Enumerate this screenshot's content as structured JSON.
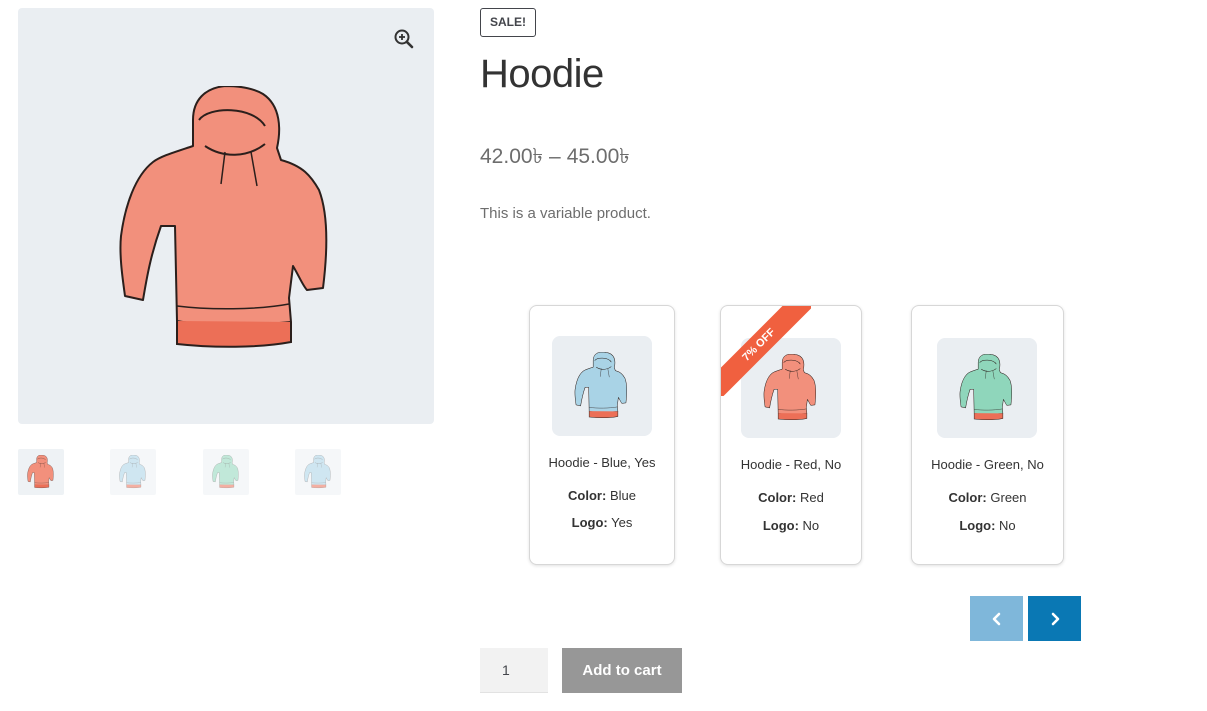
{
  "product": {
    "sale_badge": "SALE!",
    "title": "Hoodie",
    "price_min": "42.00৳",
    "price_separator": "–",
    "price_max": "45.00৳",
    "description": "This is a variable product."
  },
  "gallery": {
    "zoom_icon": "zoom-in-icon",
    "thumbnails": [
      {
        "name": "Hoodie - Red",
        "color": "#f2907c"
      },
      {
        "name": "Hoodie - Blue",
        "color": "#a9d3e6"
      },
      {
        "name": "Hoodie - Green",
        "color": "#8fd6bb"
      },
      {
        "name": "Hoodie - Blue Logo",
        "color": "#a9d3e6"
      }
    ]
  },
  "variations": [
    {
      "name": "Hoodie - Blue, Yes",
      "color_label": "Color:",
      "color_value": "Blue",
      "logo_label": "Logo:",
      "logo_value": "Yes",
      "badge": "",
      "hoodie_color": "#a9d3e6"
    },
    {
      "name": "Hoodie - Red, No",
      "color_label": "Color:",
      "color_value": "Red",
      "logo_label": "Logo:",
      "logo_value": "No",
      "badge": "7% OFF",
      "hoodie_color": "#f2907c"
    },
    {
      "name": "Hoodie - Green, No",
      "color_label": "Color:",
      "color_value": "Green",
      "logo_label": "Logo:",
      "logo_value": "No",
      "badge": "",
      "hoodie_color": "#8fd6bb"
    }
  ],
  "carousel": {
    "prev_icon": "chevron-left-icon",
    "next_icon": "chevron-right-icon"
  },
  "cart": {
    "quantity": "1",
    "add_to_cart_label": "Add to cart"
  },
  "colors": {
    "hoodie_red": "#f2907c",
    "sale_ribbon": "#f0603f",
    "nav_prev": "#7fb7da",
    "nav_next": "#0a78b4",
    "add_to_cart_bg": "#979797"
  }
}
